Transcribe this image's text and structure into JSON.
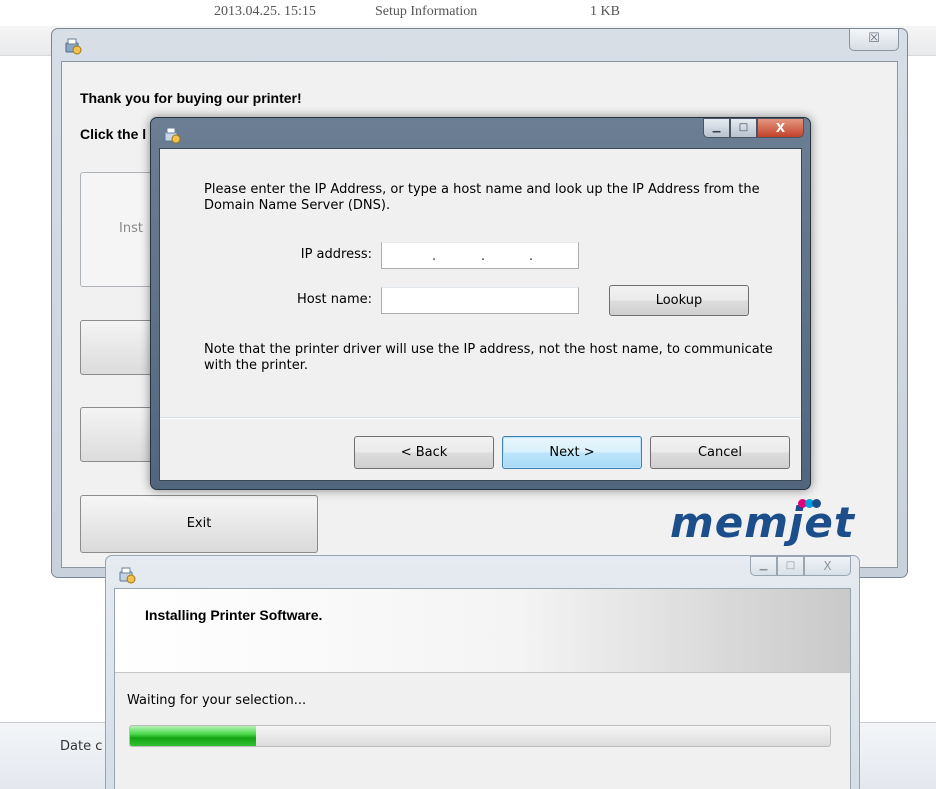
{
  "explorer": {
    "row_date": "2013.04.25. 15:15",
    "row_type": "Setup Information",
    "row_size": "1 KB",
    "date_label": "Date c"
  },
  "main_window": {
    "thanks": "Thank you for buying our printer!",
    "instruction": "Click the l",
    "option_text": "Inst",
    "exit_label": "Exit",
    "close_glyph": "☒",
    "brand": "memjet",
    "brand_dot_colors": [
      "#e2007a",
      "#00a0e3",
      "#1b4e8a"
    ]
  },
  "ip_dialog": {
    "intro": "Please enter the IP Address, or type a host name and look up the IP Address from the Domain Name Server (DNS).",
    "ip_label": "IP address:",
    "ip_value": [
      "",
      "",
      "",
      ""
    ],
    "host_label": "Host name:",
    "host_value": "",
    "lookup_label": "Lookup",
    "note": "Note that the printer driver will use the IP address, not the host name, to communicate with the printer.",
    "back_label": "< Back",
    "next_label": "Next >",
    "cancel_label": "Cancel",
    "minimize_glyph": "▁",
    "maximize_glyph": "□",
    "close_glyph": "X"
  },
  "progress_window": {
    "title": "Installing Printer Software.",
    "status": "Waiting for your selection...",
    "progress": 0.18,
    "minimize_glyph": "▁",
    "maximize_glyph": "□",
    "close_glyph": "X"
  }
}
